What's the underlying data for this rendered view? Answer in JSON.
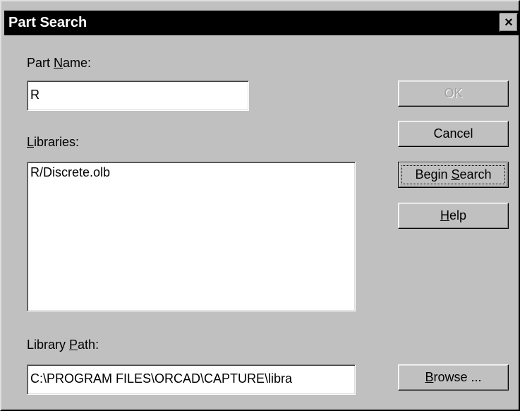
{
  "window": {
    "title": "Part Search",
    "close_glyph": "×"
  },
  "part_name": {
    "label_pre": "Part ",
    "label_key": "N",
    "label_post": "ame:",
    "value": "R"
  },
  "libraries": {
    "label_key": "L",
    "label_post": "ibraries:",
    "items": [
      "R/Discrete.olb"
    ]
  },
  "library_path": {
    "label_pre": "Library ",
    "label_key": "P",
    "label_post": "ath:",
    "value": "C:\\PROGRAM FILES\\ORCAD\\CAPTURE\\libra"
  },
  "buttons": {
    "ok": "OK",
    "cancel": "Cancel",
    "begin_search_pre": "Begin ",
    "begin_search_key": "S",
    "begin_search_post": "earch",
    "help_key": "H",
    "help_post": "elp",
    "browse_key": "B",
    "browse_post": "rowse ..."
  },
  "colors": {
    "dialog_bg": "#c0c0c0",
    "titlebar_bg": "#000000",
    "title_text": "#ffffff",
    "field_bg": "#ffffff"
  }
}
